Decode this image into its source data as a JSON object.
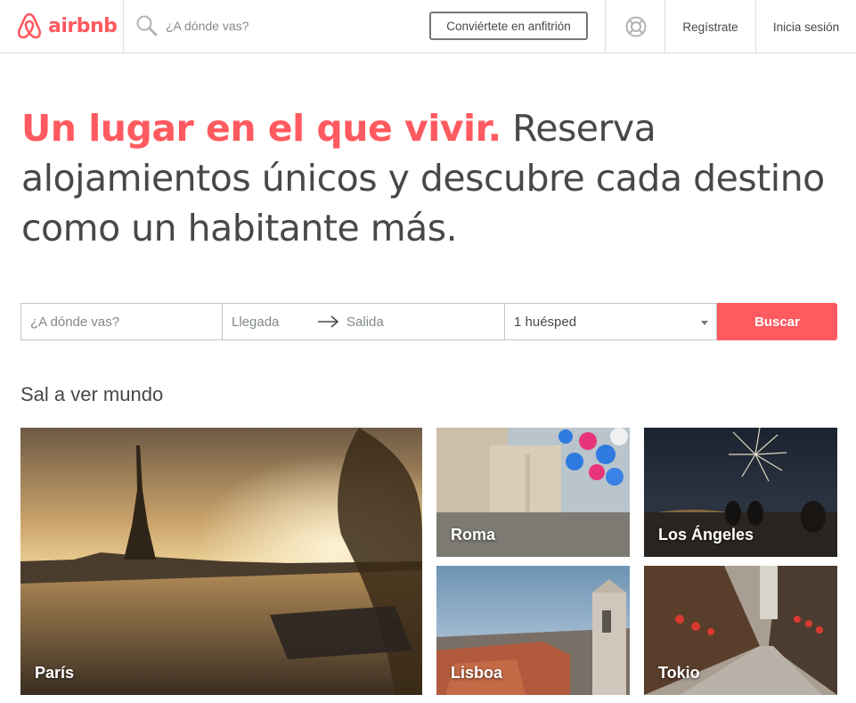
{
  "brand": {
    "name": "airbnb",
    "color": "#ff5a5f"
  },
  "header": {
    "search_placeholder": "¿A dónde vas?",
    "host_button": "Conviértete en anfitrión",
    "help_icon": "lifebuoy-icon",
    "signup": "Regístrate",
    "login": "Inicia sesión"
  },
  "hero": {
    "accent": "Un lugar en el que vivir.",
    "rest": " Reserva alojamientos únicos y descubre cada destino como un habitante más."
  },
  "searchbar": {
    "where_placeholder": "¿A dónde vas?",
    "checkin_placeholder": "Llegada",
    "checkout_placeholder": "Salida",
    "guests_value": "1 huésped",
    "submit": "Buscar"
  },
  "explore": {
    "title": "Sal a ver mundo",
    "cities": [
      {
        "name": "París"
      },
      {
        "name": "Roma"
      },
      {
        "name": "Los Ángeles"
      },
      {
        "name": "Lisboa"
      },
      {
        "name": "Tokio"
      }
    ]
  }
}
